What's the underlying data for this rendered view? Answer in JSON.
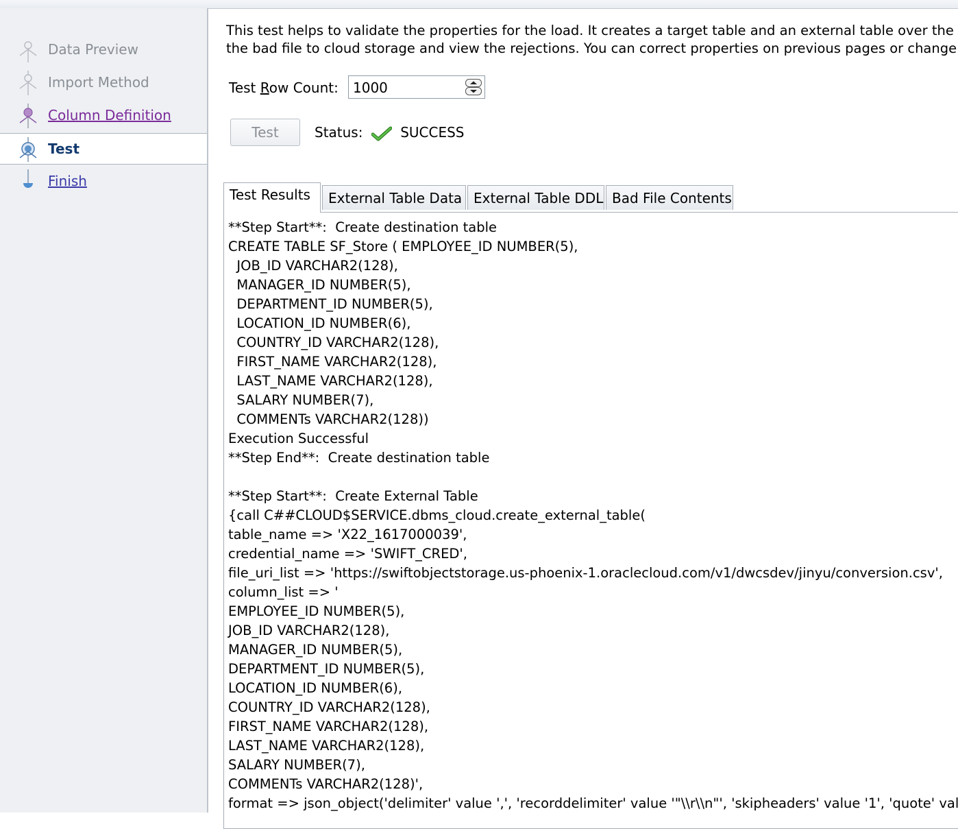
{
  "steps": [
    {
      "label": "Data Preview",
      "state": "disabled"
    },
    {
      "label": "Import Method",
      "state": "disabled"
    },
    {
      "label": "Column Definition",
      "state": "visited"
    },
    {
      "label": "Test",
      "state": "current"
    },
    {
      "label": "Finish",
      "state": "link"
    }
  ],
  "intro": {
    "line1": "This test helps to validate the properties for the load.  It creates a target table and an external table over the c",
    "line2": "the bad file to cloud storage and view the rejections.  You can correct properties on previous pages or change t"
  },
  "row_count": {
    "label_before": "Test ",
    "label_mnemonic": "R",
    "label_after": "ow Count:",
    "value": "1000"
  },
  "test_button": {
    "label": "Test"
  },
  "status": {
    "label": "Status:",
    "value": "SUCCESS",
    "color": "#3fa02f"
  },
  "tabs": [
    {
      "label": "Test Results",
      "active": true
    },
    {
      "label": "External Table Data",
      "active": false
    },
    {
      "label": "External Table DDL",
      "active": false
    },
    {
      "label": "Bad File Contents",
      "active": false
    }
  ],
  "results_lines": [
    "**Step Start**:  Create destination table",
    "CREATE TABLE SF_Store ( EMPLOYEE_ID NUMBER(5),",
    "  JOB_ID VARCHAR2(128),",
    "  MANAGER_ID NUMBER(5),",
    "  DEPARTMENT_ID NUMBER(5),",
    "  LOCATION_ID NUMBER(6),",
    "  COUNTRY_ID VARCHAR2(128),",
    "  FIRST_NAME VARCHAR2(128),",
    "  LAST_NAME VARCHAR2(128),",
    "  SALARY NUMBER(7),",
    "  COMMENTs VARCHAR2(128))",
    "Execution Successful",
    "**Step End**:  Create destination table",
    "",
    "**Step Start**:  Create External Table",
    "{call C##CLOUD$SERVICE.dbms_cloud.create_external_table(",
    "table_name => 'X22_1617000039',",
    "credential_name => 'SWIFT_CRED',",
    "file_uri_list => 'https://swiftobjectstorage.us-phoenix-1.oraclecloud.com/v1/dwcsdev/jinyu/conversion.csv',",
    "column_list => '",
    "EMPLOYEE_ID NUMBER(5),",
    "JOB_ID VARCHAR2(128),",
    "MANAGER_ID NUMBER(5),",
    "DEPARTMENT_ID NUMBER(5),",
    "LOCATION_ID NUMBER(6),",
    "COUNTRY_ID VARCHAR2(128),",
    "FIRST_NAME VARCHAR2(128),",
    "LAST_NAME VARCHAR2(128),",
    "SALARY NUMBER(7),",
    "COMMENTs VARCHAR2(128)',",
    "format => json_object('delimiter' value ',', 'recorddelimiter' value '\"\\\\r\\\\n\"', 'skipheaders' value '1', 'quote' value '"
  ]
}
